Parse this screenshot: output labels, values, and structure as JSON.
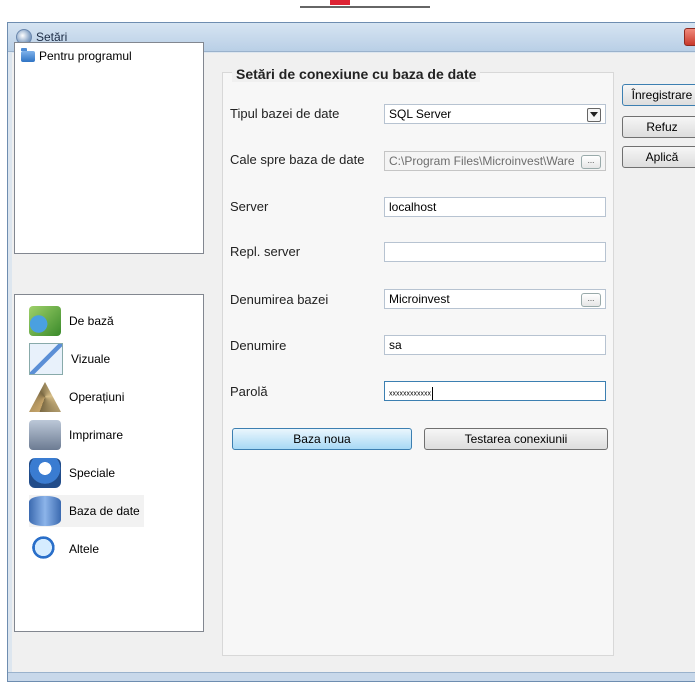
{
  "window": {
    "title": "Setări"
  },
  "tree": {
    "items": [
      {
        "label": "Pentru programul"
      }
    ]
  },
  "categories": [
    {
      "label": "De bază",
      "icon": "settings-wrench-icon"
    },
    {
      "label": "Vizuale",
      "icon": "chart-icon"
    },
    {
      "label": "Operațiuni",
      "icon": "compass-icon"
    },
    {
      "label": "Imprimare",
      "icon": "printer-icon"
    },
    {
      "label": "Speciale",
      "icon": "special-icon"
    },
    {
      "label": "Baza de date",
      "icon": "database-icon"
    },
    {
      "label": "Altele",
      "icon": "magnifier-icon"
    }
  ],
  "form": {
    "heading": "Setări de conexiune cu baza de date",
    "db_type_label": "Tipul bazei de date",
    "db_type_value": "SQL Server",
    "db_path_label": "Cale spre baza de date",
    "db_path_value": "C:\\Program Files\\Microinvest\\Ware",
    "server_label": "Server",
    "server_value": "localhost",
    "repl_server_label": "Repl. server",
    "repl_server_value": "",
    "db_name_label": "Denumirea bazei",
    "db_name_value": "Microinvest",
    "user_label": "Denumire",
    "user_value": "sa",
    "password_label": "Parolă",
    "password_value": "xxxxxxxxxxxx",
    "browse_label": "...",
    "new_db_button": "Baza noua",
    "test_button": "Testarea conexiunii"
  },
  "side_buttons": {
    "save": "Înregistrare",
    "cancel": "Refuz",
    "apply": "Aplică"
  }
}
